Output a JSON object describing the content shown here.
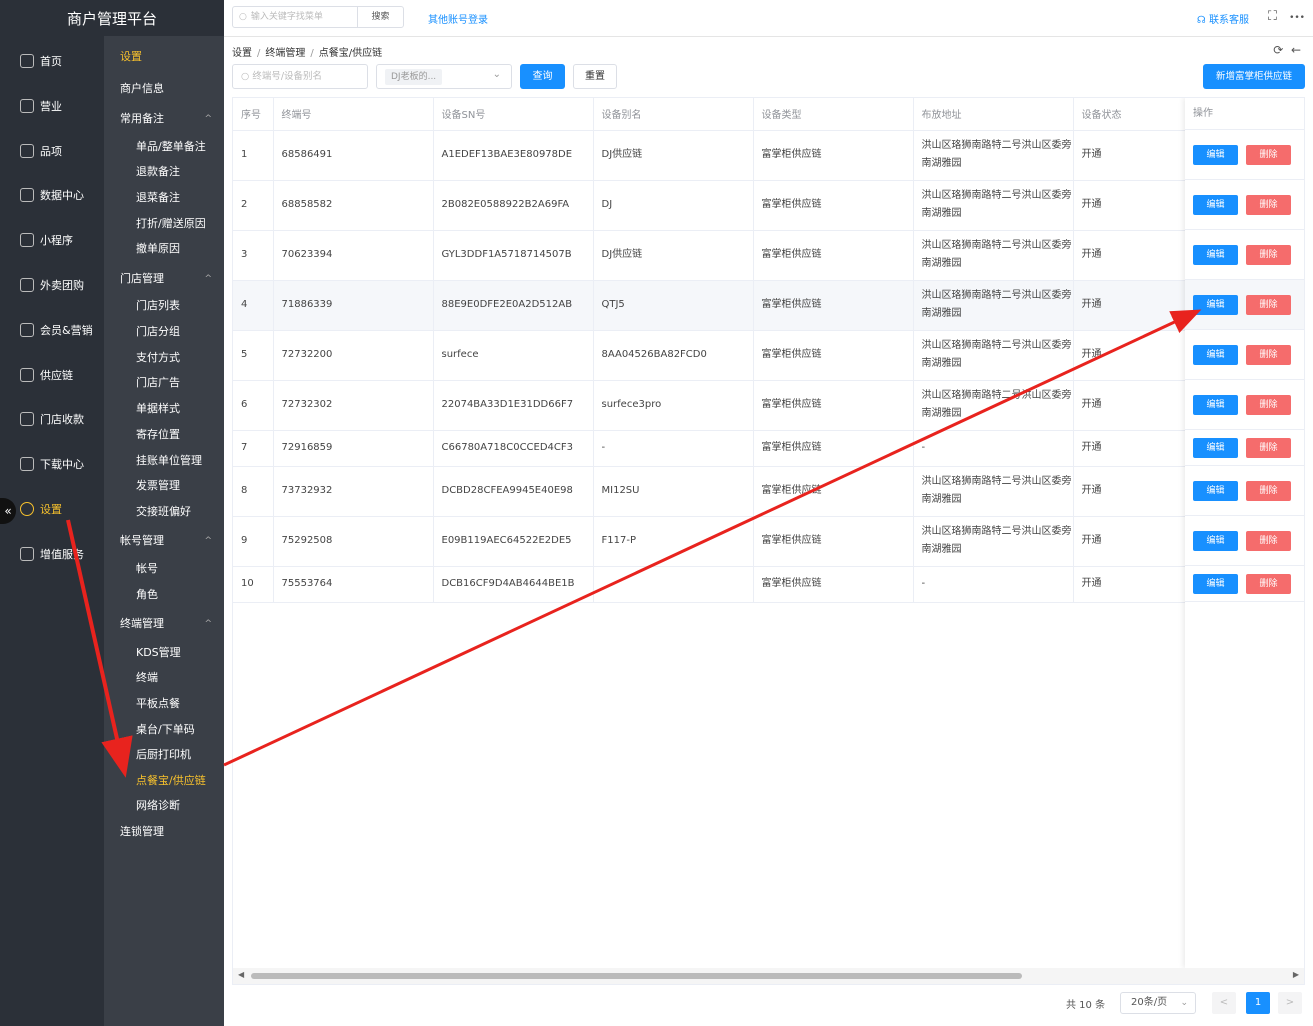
{
  "app": {
    "title": "商户管理平台"
  },
  "sidebar": {
    "items": [
      {
        "label": "首页",
        "icon": "home-icon"
      },
      {
        "label": "营业",
        "icon": "business-icon"
      },
      {
        "label": "品项",
        "icon": "product-icon"
      },
      {
        "label": "数据中心",
        "icon": "share-icon"
      },
      {
        "label": "小程序",
        "icon": "miniapp-icon"
      },
      {
        "label": "外卖团购",
        "icon": "bike-icon"
      },
      {
        "label": "会员&营销",
        "icon": "user-icon"
      },
      {
        "label": "供应链",
        "icon": "truck-icon"
      },
      {
        "label": "门店收款",
        "icon": "coins-icon"
      },
      {
        "label": "下载中心",
        "icon": "download-icon"
      },
      {
        "label": "设置",
        "icon": "gear-icon"
      },
      {
        "label": "增值服务",
        "icon": "alarm-icon"
      }
    ],
    "collapse_glyph": "«"
  },
  "submenu": {
    "title": "设置",
    "items": [
      {
        "label": "商户信息",
        "type": "group"
      },
      {
        "label": "常用备注",
        "type": "group",
        "arrow": "^"
      },
      {
        "label": "单品/整单备注",
        "type": "sub"
      },
      {
        "label": "退款备注",
        "type": "sub"
      },
      {
        "label": "退菜备注",
        "type": "sub"
      },
      {
        "label": "打折/赠送原因",
        "type": "sub"
      },
      {
        "label": "撤单原因",
        "type": "sub"
      },
      {
        "label": "门店管理",
        "type": "group",
        "arrow": "^"
      },
      {
        "label": "门店列表",
        "type": "sub"
      },
      {
        "label": "门店分组",
        "type": "sub"
      },
      {
        "label": "支付方式",
        "type": "sub"
      },
      {
        "label": "门店广告",
        "type": "sub"
      },
      {
        "label": "单据样式",
        "type": "sub"
      },
      {
        "label": "寄存位置",
        "type": "sub"
      },
      {
        "label": "挂账单位管理",
        "type": "sub"
      },
      {
        "label": "发票管理",
        "type": "sub"
      },
      {
        "label": "交接班偏好",
        "type": "sub"
      },
      {
        "label": "帐号管理",
        "type": "group",
        "arrow": "^"
      },
      {
        "label": "帐号",
        "type": "sub"
      },
      {
        "label": "角色",
        "type": "sub"
      },
      {
        "label": "终端管理",
        "type": "group",
        "arrow": "^"
      },
      {
        "label": "KDS管理",
        "type": "sub"
      },
      {
        "label": "终端",
        "type": "sub"
      },
      {
        "label": "平板点餐",
        "type": "sub"
      },
      {
        "label": "桌台/下单码",
        "type": "sub"
      },
      {
        "label": "后厨打印机",
        "type": "sub"
      },
      {
        "label": "点餐宝/供应链",
        "type": "sub",
        "active": true
      },
      {
        "label": "网络诊断",
        "type": "sub"
      },
      {
        "label": "连锁管理",
        "type": "group"
      }
    ]
  },
  "topbar": {
    "search_placeholder": "输入关键字找菜单",
    "search_button": "搜索",
    "other_login": "其他账号登录",
    "contact": "联系客服",
    "fullscreen_glyph": "⛶",
    "more_glyph": "•••"
  },
  "breadcrumb": {
    "items": [
      "设置",
      "终端管理",
      "点餐宝/供应链"
    ],
    "sep": "/"
  },
  "filters": {
    "terminal_placeholder": "终端号/设备别名",
    "merchant_tag": "DJ老板的...",
    "query_button": "查询",
    "reset_button": "重置",
    "add_button": "新增富掌柜供应链"
  },
  "table": {
    "columns": [
      "序号",
      "终端号",
      "设备SN号",
      "设备别名",
      "设备类型",
      "布放地址",
      "设备状态"
    ],
    "op_header": "操作",
    "edit_label": "编辑",
    "delete_label": "删除",
    "rows": [
      [
        "1",
        "68586491",
        "A1EDEF13BAE3E80978DE",
        "DJ供应链",
        "富掌柜供应链",
        "洪山区珞狮南路特二号洪山区委旁南湖雅园",
        "开通"
      ],
      [
        "2",
        "68858582",
        "2B082E0588922B2A69FA",
        "DJ",
        "富掌柜供应链",
        "洪山区珞狮南路特二号洪山区委旁南湖雅园",
        "开通"
      ],
      [
        "3",
        "70623394",
        "GYL3DDF1A5718714507B",
        "DJ供应链",
        "富掌柜供应链",
        "洪山区珞狮南路特二号洪山区委旁南湖雅园",
        "开通"
      ],
      [
        "4",
        "71886339",
        "88E9E0DFE2E0A2D512AB",
        "QTJ5",
        "富掌柜供应链",
        "洪山区珞狮南路特二号洪山区委旁南湖雅园",
        "开通"
      ],
      [
        "5",
        "72732200",
        "surfece",
        "8AA04526BA82FCD0",
        "富掌柜供应链",
        "洪山区珞狮南路特二号洪山区委旁南湖雅园",
        "开通"
      ],
      [
        "6",
        "72732302",
        "22074BA33D1E31DD66F7",
        "surfece3pro",
        "富掌柜供应链",
        "洪山区珞狮南路特二号洪山区委旁南湖雅园",
        "开通"
      ],
      [
        "7",
        "72916859",
        "C66780A718C0CCED4CF3",
        "-",
        "富掌柜供应链",
        "-",
        "开通"
      ],
      [
        "8",
        "73732932",
        "DCBD28CFEA9945E40E98",
        "MI12SU",
        "富掌柜供应链",
        "洪山区珞狮南路特二号洪山区委旁南湖雅园",
        "开通"
      ],
      [
        "9",
        "75292508",
        "E09B119AEC64522E2DE5",
        "F117-P",
        "富掌柜供应链",
        "洪山区珞狮南路特二号洪山区委旁南湖雅园",
        "开通"
      ],
      [
        "10",
        "75553764",
        "DCB16CF9D4AB4644BE1B",
        "",
        "富掌柜供应链",
        "-",
        "开通"
      ]
    ]
  },
  "pagination": {
    "total": "共 10 条",
    "page_size": "20条/页",
    "current": "1",
    "prev": "<",
    "next": ">"
  },
  "colors": {
    "accent": "#1890ff",
    "danger": "#f56c6c",
    "active": "#f7c12d",
    "annotation": "#e8231e"
  }
}
